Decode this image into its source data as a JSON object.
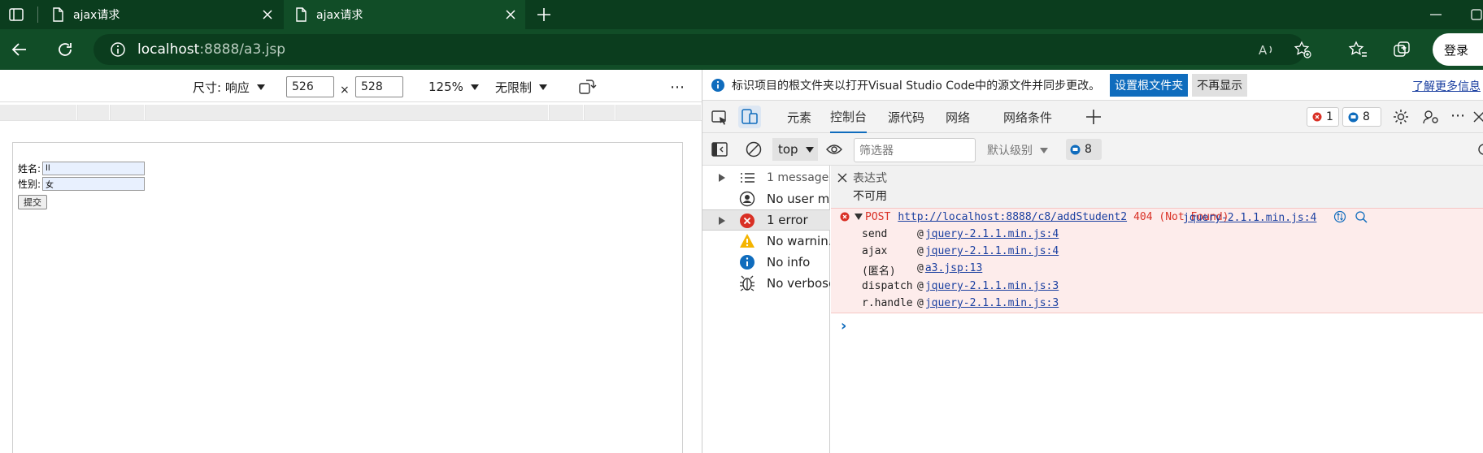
{
  "browser": {
    "tabs": [
      {
        "title": "ajax请求",
        "active": false
      },
      {
        "title": "ajax请求",
        "active": true
      }
    ],
    "url_host": "localhost",
    "url_path": ":8888/a3.jsp",
    "profile_button": "登录"
  },
  "device_toolbar": {
    "dimensions_label": "尺寸: 响应",
    "width": "526",
    "times": "×",
    "height": "528",
    "zoom": "125%",
    "throttle": "无限制",
    "more": "⋯"
  },
  "page_form": {
    "name_label": "姓名:",
    "name_value": "ll",
    "gender_label": "性别:",
    "gender_value": "女",
    "submit_label": "提交"
  },
  "devtools": {
    "info_text": "标识项目的根文件夹以打开Visual Studio Code中的源文件并同步更改。",
    "set_root_button": "设置根文件夹",
    "dont_show_button": "不再显示",
    "learn_more": "了解更多信息",
    "tabs": [
      "元素",
      "控制台",
      "源代码",
      "网络",
      "网络条件"
    ],
    "active_tab": "控制台",
    "error_count": "1",
    "message_count": "8",
    "context": "top",
    "filter_placeholder": "筛选器",
    "level": "默认级别",
    "issues_count": "8",
    "sidebar": [
      {
        "label": "1 message",
        "icon": "list-icon",
        "expandable": true
      },
      {
        "label": "No user m...",
        "icon": "user-icon",
        "expandable": false
      },
      {
        "label": "1 error",
        "icon": "error-icon",
        "expandable": true
      },
      {
        "label": "No warnin...",
        "icon": "warning-icon",
        "expandable": false
      },
      {
        "label": "No info",
        "icon": "info-icon",
        "expandable": false
      },
      {
        "label": "No verbose",
        "icon": "bug-icon",
        "expandable": false
      }
    ],
    "expression": {
      "title": "表达式",
      "value": "不可用"
    },
    "error": {
      "method": "POST",
      "url": "http://localhost:8888/c8/addStudent2",
      "status": "404 (Not Found)",
      "source": "jquery-2.1.1.min.js:4",
      "stack": [
        {
          "fn": "send",
          "at": "@",
          "src": "jquery-2.1.1.min.js:4"
        },
        {
          "fn": "ajax",
          "at": "@",
          "src": "jquery-2.1.1.min.js:4"
        },
        {
          "fn": "(匿名)",
          "at": "@",
          "src": "a3.jsp:13"
        },
        {
          "fn": "dispatch",
          "at": "@",
          "src": "jquery-2.1.1.min.js:3"
        },
        {
          "fn": "r.handle",
          "at": "@",
          "src": "jquery-2.1.1.min.js:3"
        }
      ]
    },
    "prompt": "›"
  },
  "colors": {
    "tabstrip": "#0b3d1e",
    "addressbar": "#114d27",
    "accent": "#0f6cbd",
    "error": "#d93025"
  }
}
